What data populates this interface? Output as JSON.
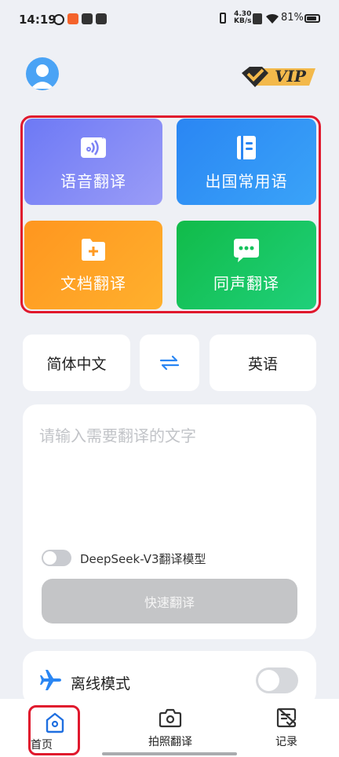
{
  "status_bar": {
    "time": "14:19",
    "net_speed": "4.30",
    "net_unit": "KB/s",
    "battery": "81%"
  },
  "header": {
    "vip_label": "VIP"
  },
  "features": [
    {
      "label": "语音翻译",
      "icon": "audio-card-icon"
    },
    {
      "label": "出国常用语",
      "icon": "notebook-icon"
    },
    {
      "label": "文档翻译",
      "icon": "folder-add-icon"
    },
    {
      "label": "同声翻译",
      "icon": "chat-bubble-icon"
    }
  ],
  "language": {
    "source": "简体中文",
    "target": "英语",
    "swap_icon": "swap-arrows-icon"
  },
  "input": {
    "placeholder": "请输入需要翻译的文字",
    "model_label": "DeepSeek-V3翻译模型",
    "model_toggle_on": false,
    "quick_translate_label": "快速翻译"
  },
  "offline": {
    "label": "离线模式",
    "enabled": false
  },
  "bottom_nav": {
    "home": "首页",
    "photo": "拍照翻译",
    "record": "记录"
  },
  "colors": {
    "highlight_border": "#e0182d",
    "tile_voice": "#6d79f5",
    "tile_phrases": "#2a86f3",
    "tile_document": "#ff961f",
    "tile_simultaneous": "#11bb49",
    "swap_icon": "#2a86f3"
  }
}
